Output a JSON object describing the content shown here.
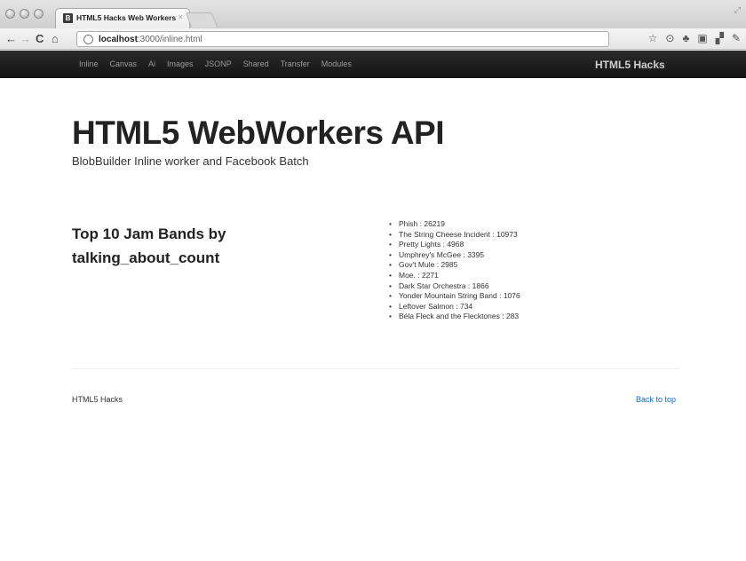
{
  "browser": {
    "tab_title": "HTML5 Hacks Web Workers",
    "tab_favicon": "B",
    "tab_close": "×",
    "url_host": "localhost",
    "url_rest": ":3000/inline.html"
  },
  "icons": {
    "back": "←",
    "forward": "→",
    "reload": "C",
    "home": "⌂",
    "star": "☆",
    "ext1": "⊙",
    "ext2": "♣",
    "ext3": "▣",
    "ext4": "▞",
    "wrench": "✎",
    "resize": "⤢"
  },
  "navbar": {
    "links": [
      "Inline",
      "Canvas",
      "Ai",
      "Images",
      "JSONP",
      "Shared",
      "Transfer",
      "Modules"
    ],
    "brand": "HTML5 Hacks"
  },
  "main": {
    "title": "HTML5 WebWorkers API",
    "subtitle": "BlobBuilder Inline worker and Facebook Batch",
    "section_title": "Top 10 Jam Bands by talking_about_count",
    "bands": [
      "Phish : 26219",
      "The String Cheese Incident : 10973",
      "Pretty Lights : 4968",
      "Umphrey's McGee : 3395",
      "Gov't Mule : 2985",
      "Moe. : 2271",
      "Dark Star Orchestra : 1866",
      "Yonder Mountain String Band : 1076",
      "Leftover Salmon : 734",
      "Béla Fleck and the Flecktones : 283"
    ]
  },
  "footer": {
    "left": "HTML5 Hacks",
    "back_to_top": "Back to top"
  }
}
